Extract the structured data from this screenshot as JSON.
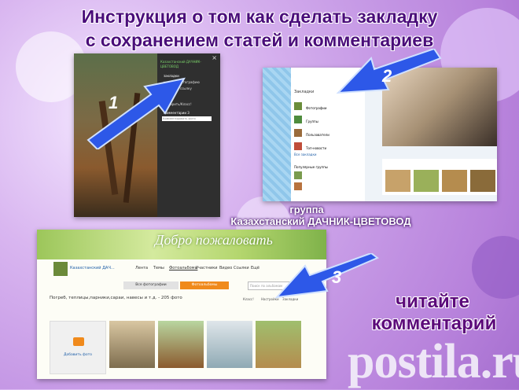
{
  "title": {
    "line1": "Инструкция о том как сделать закладку",
    "line2": "с сохранением статей и  комментариев"
  },
  "panel1": {
    "close": "×",
    "header": "Казахстанский ДАЧНИК-ЦВЕТОВОД",
    "menu": [
      "закладки",
      "удалить фотографию",
      "получить ссылку",
      "Ок!",
      "Подарить/Класс!",
      "Комментарии 3"
    ],
    "input_placeholder": "Комментировать фото",
    "badge": "1"
  },
  "panel2": {
    "badge": "2",
    "side_title": "Закладки",
    "side_items": [
      "Фотографии",
      "Группы",
      "Пользователи",
      "Топ-новости"
    ],
    "side_link": "Все закладки",
    "groups_title": "Популярные группы"
  },
  "caption": {
    "line1": "группа",
    "line2": "Казахстанский ДАЧНИК-ЦВЕТОВОД"
  },
  "panel3": {
    "banner": "Добро пожаловать",
    "group_name": "Казахстанский ДАЧ...",
    "nav": [
      "Лента",
      "Темы",
      "Фотоальбомы",
      "Участники",
      "Видео",
      "Ссылки",
      "Ещё"
    ],
    "tab_all": "Все фотографии",
    "tab_albums": "Фотоальбомы",
    "search_placeholder": "Поиск по альбомам",
    "album_title": "Погреб, теплицы,парники,сараи, навесы и т.д. - 205 фото",
    "actions": [
      "Класс!",
      "Настройки",
      "Закладки"
    ],
    "add_photo": "Добавить фото",
    "badge": "3"
  },
  "side_text": {
    "line1": "читайте",
    "line2": "комментарий"
  },
  "watermark": "postila.ru",
  "colors": {
    "arrow": "#2d58e8",
    "title": "#4a0d7a",
    "panel1_bg": "#2b2b2b",
    "accent_orange": "#f08a1c"
  }
}
